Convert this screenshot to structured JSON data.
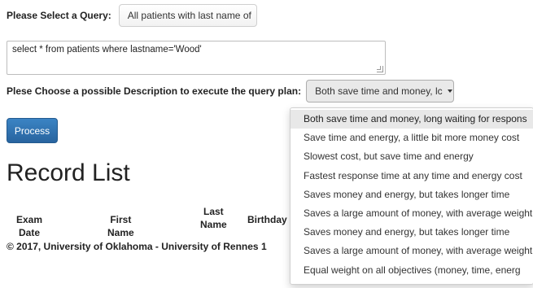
{
  "query": {
    "label": "Please Select a Query:",
    "selected": "All patients with last name of"
  },
  "sql": {
    "value": "select * from patients where lastname='Wood'"
  },
  "description": {
    "label": "Plese Choose a possible Description to execute the query plan:",
    "selected": "Both save time and money, lc",
    "options": [
      "Both save time and money, long waiting for respons",
      "Save time and energy, a little bit more money cost",
      "Slowest cost, but save time and energy",
      "Fastest response time at any time and energy cost",
      "Saves money and energy, but takes longer time",
      "Saves a large amount of money, with average weight",
      "Saves money and energy, but takes longer time",
      "Saves a large amount of money, with average weight",
      "Equal weight on all objectives (money, time, energ"
    ]
  },
  "actions": {
    "process_label": "Process"
  },
  "records": {
    "title": "Record List",
    "columns": {
      "exam_date": "Exam Date",
      "first_name": "First Name",
      "last_name_1": "Last",
      "last_name_2": "Name",
      "birthday": "Birthday"
    }
  },
  "footer": {
    "text": "© 2017, University of Oklahoma - University of Rennes 1"
  },
  "colors": {
    "primary_button": "#337ab7",
    "menu_active_bg": "#e8e8e8"
  }
}
